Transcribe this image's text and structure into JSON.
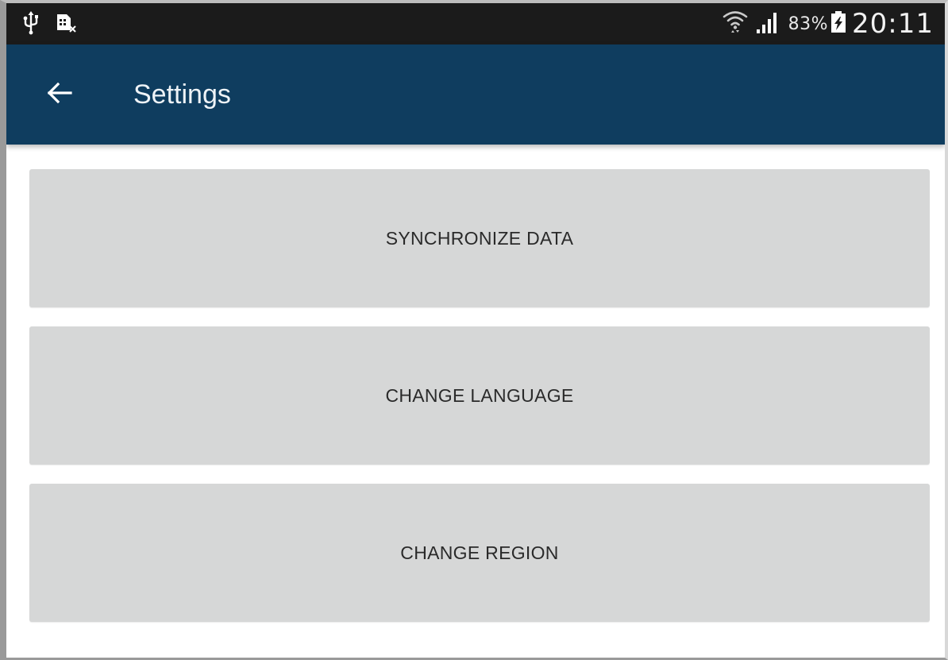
{
  "status_bar": {
    "icons_left": [
      "usb-icon",
      "sim-card-icon"
    ],
    "icons_right": [
      "wifi-icon",
      "signal-icon",
      "battery-icon"
    ],
    "battery_percent": "83%",
    "time": "20:11"
  },
  "app_bar": {
    "back_icon": "arrow-left-icon",
    "title": "Settings",
    "color": "#0f3d5f"
  },
  "settings": {
    "buttons": [
      {
        "label": "SYNCHRONIZE DATA"
      },
      {
        "label": "CHANGE LANGUAGE"
      },
      {
        "label": "CHANGE REGION"
      }
    ],
    "button_color": "#d6d7d7"
  }
}
